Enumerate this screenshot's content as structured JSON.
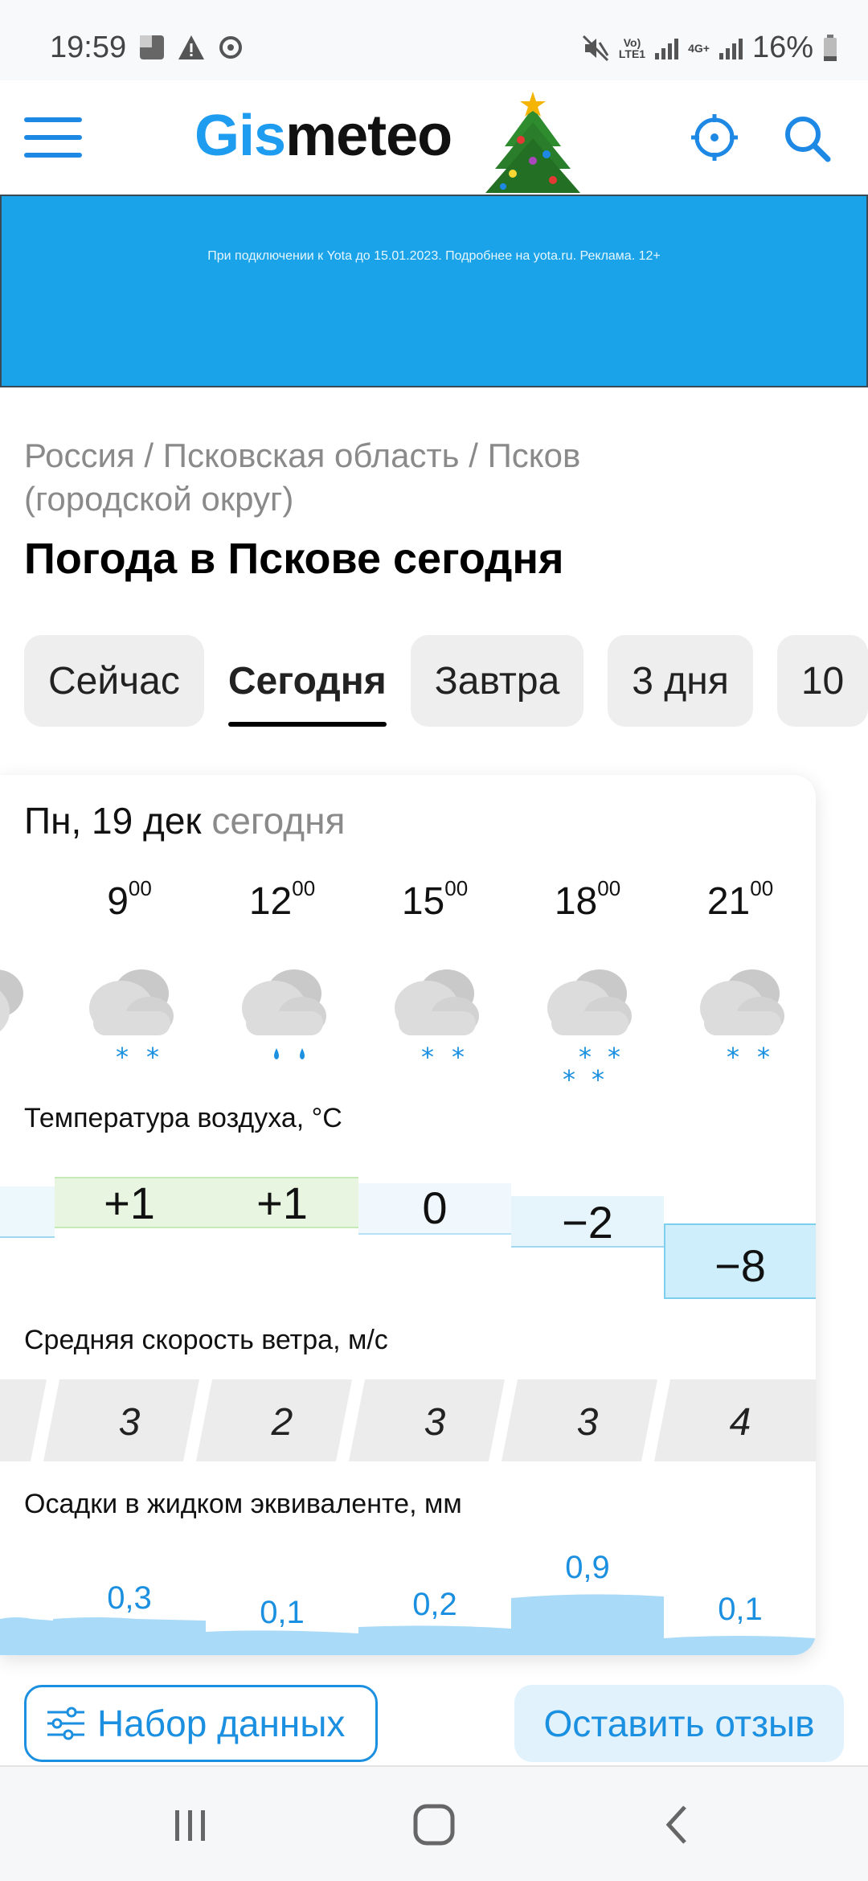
{
  "status_bar": {
    "time": "19:59",
    "volte_label_1": "Vo)",
    "volte_label_2": "LTE1",
    "net_label": "4G+",
    "battery": "16%"
  },
  "header": {
    "logo_part1": "Gis",
    "logo_part2": "meteo"
  },
  "ad": {
    "text": "При подключении к Yota до 15.01.2023. Подробнее на yota.ru. Реклама. 12+"
  },
  "breadcrumb": {
    "country": "Россия",
    "region": "Псковская область",
    "city": "Псков (городской округ)",
    "separator": "/"
  },
  "title": "Погода в Пскове сегодня",
  "tabs": [
    {
      "label": "Сейчас"
    },
    {
      "label": "Сегодня"
    },
    {
      "label": "Завтра"
    },
    {
      "label": "3 дня"
    },
    {
      "label": "10"
    }
  ],
  "forecast": {
    "day": "Пн, 19 дек",
    "relative": "сегодня",
    "hours": [
      {
        "h": "9",
        "m": "00",
        "icon": "cloud-snow-icon",
        "temp": "+1",
        "wind": "3",
        "precip": "0,3"
      },
      {
        "h": "12",
        "m": "00",
        "icon": "cloud-rain-icon",
        "temp": "+1",
        "wind": "2",
        "precip": "0,1"
      },
      {
        "h": "15",
        "m": "00",
        "icon": "cloud-snow-icon",
        "temp": "0",
        "wind": "3",
        "precip": "0,2"
      },
      {
        "h": "18",
        "m": "00",
        "icon": "cloud-heavy-snow-icon",
        "temp": "−2",
        "wind": "3",
        "precip": "0,9"
      },
      {
        "h": "21",
        "m": "00",
        "icon": "cloud-snow-icon",
        "temp": "−8",
        "wind": "4",
        "precip": "0,1"
      }
    ],
    "labels": {
      "temperature": "Температура воздуха, °C",
      "wind": "Средняя скорость ветра, м/с",
      "precip": "Осадки в жидком эквиваленте, мм"
    }
  },
  "buttons": {
    "dataset": "Набор данных",
    "feedback": "Оставить отзыв"
  },
  "colors": {
    "brand_blue": "#1e9cf0",
    "ad_bg": "#1aa3e8",
    "warm_temp_bg": "#e8f6e1",
    "cold_temp_bg": "#cdeefa"
  }
}
